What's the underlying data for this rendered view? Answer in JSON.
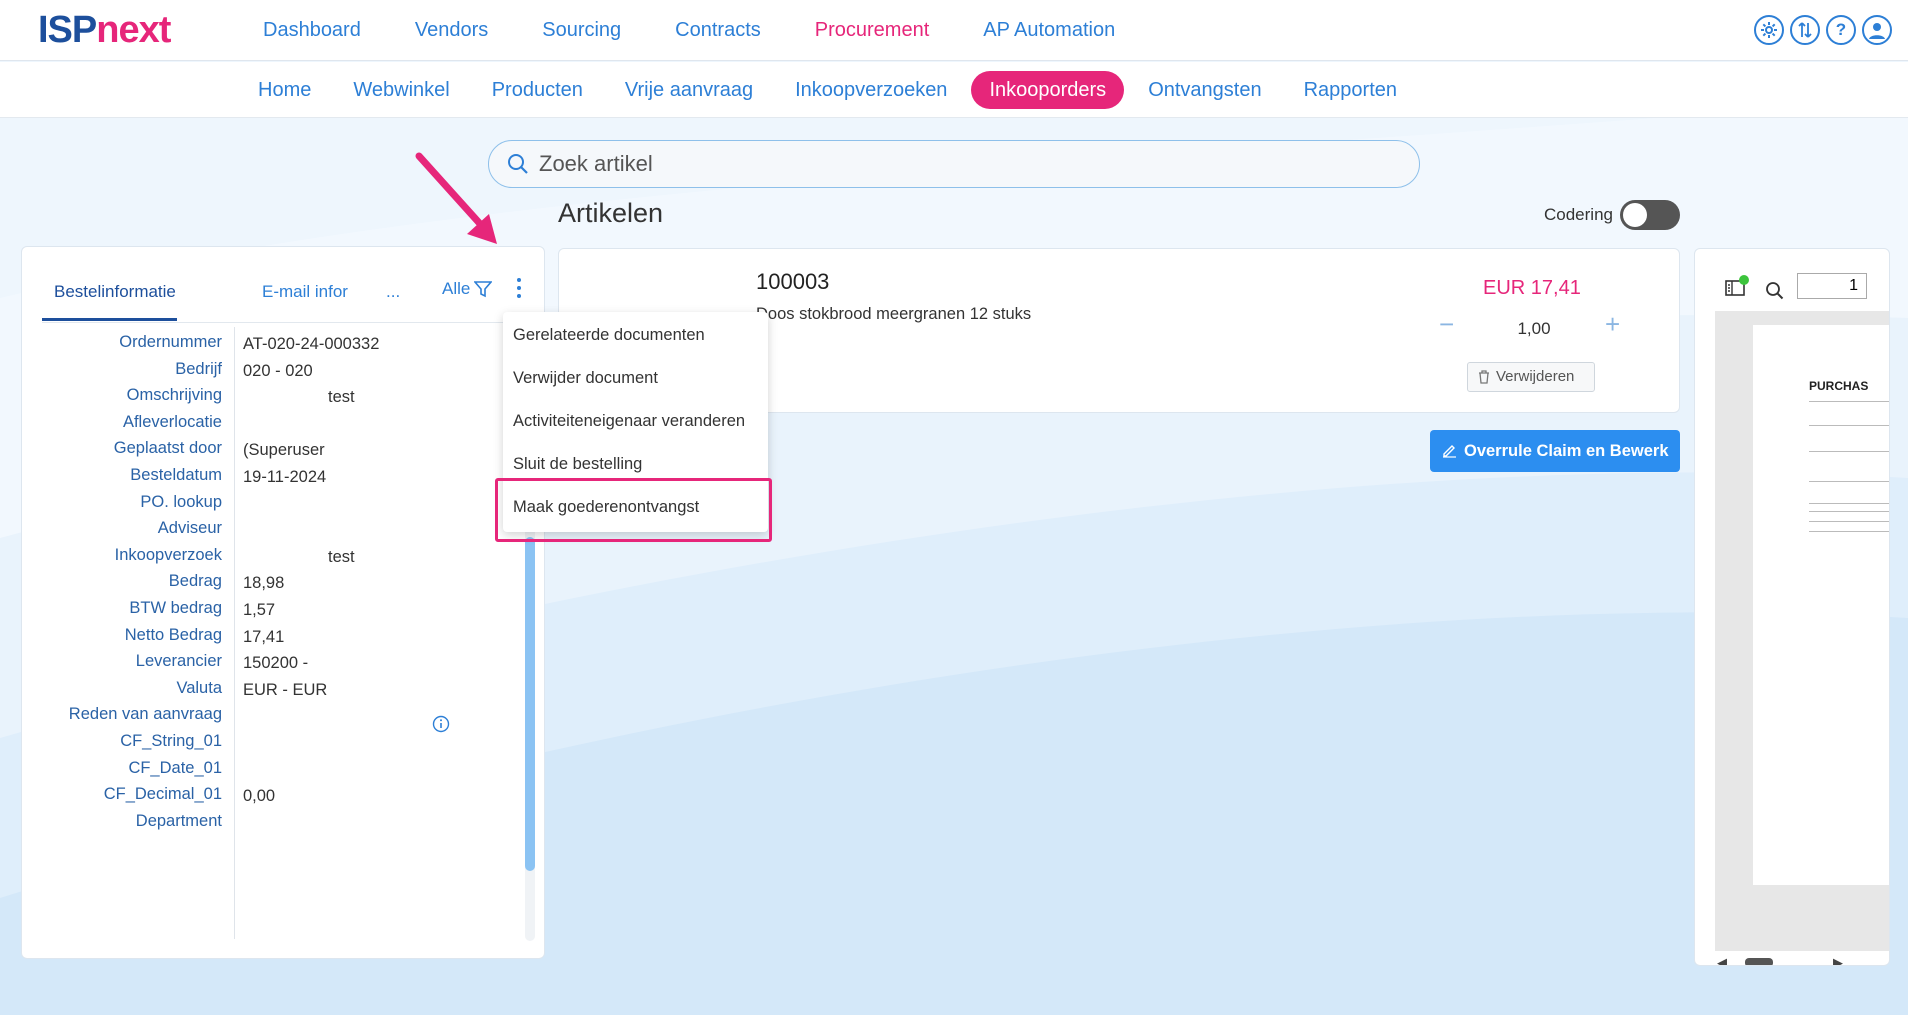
{
  "brand": {
    "part1": "ISP",
    "part2": "next",
    "color1": "#1d4f9c",
    "color2": "#e6267a"
  },
  "main_nav": [
    {
      "label": "Dashboard",
      "active": false
    },
    {
      "label": "Vendors",
      "active": false
    },
    {
      "label": "Sourcing",
      "active": false
    },
    {
      "label": "Contracts",
      "active": false
    },
    {
      "label": "Procurement",
      "active": true
    },
    {
      "label": "AP Automation",
      "active": false
    }
  ],
  "top_icons": [
    "gear-icon",
    "sync-icon",
    "help-icon",
    "user-icon"
  ],
  "sub_nav": [
    {
      "label": "Home",
      "active": false
    },
    {
      "label": "Webwinkel",
      "active": false
    },
    {
      "label": "Producten",
      "active": false
    },
    {
      "label": "Vrije aanvraag",
      "active": false
    },
    {
      "label": "Inkoopverzoeken",
      "active": false
    },
    {
      "label": "Inkooporders",
      "active": true
    },
    {
      "label": "Ontvangsten",
      "active": false
    },
    {
      "label": "Rapporten",
      "active": false
    }
  ],
  "search": {
    "placeholder": "Zoek artikel"
  },
  "left_panel": {
    "tabs": {
      "t1": "Bestelinformatie",
      "t2": "E-mail infor",
      "t3": "..."
    },
    "filter_label": "Alle",
    "fields": [
      {
        "label": "Ordernummer",
        "value": "AT-020-24-000332",
        "indent": false
      },
      {
        "label": "Bedrijf",
        "value": "020 - 020",
        "indent": false
      },
      {
        "label": "Omschrijving",
        "value": "test",
        "indent": true
      },
      {
        "label": "Afleverlocatie",
        "value": "",
        "indent": false
      },
      {
        "label": "Geplaatst door",
        "value": "(Superuser",
        "indent": false
      },
      {
        "label": "Besteldatum",
        "value": "19-11-2024",
        "indent": false
      },
      {
        "label": "PO. lookup",
        "value": "",
        "indent": false
      },
      {
        "label": "Adviseur",
        "value": "",
        "indent": false
      },
      {
        "label": "Inkoopverzoek",
        "value": "test",
        "indent": true
      },
      {
        "label": "Bedrag",
        "value": "18,98",
        "indent": false
      },
      {
        "label": "BTW bedrag",
        "value": "1,57",
        "indent": false
      },
      {
        "label": "Netto Bedrag",
        "value": "17,41",
        "indent": false
      },
      {
        "label": "Leverancier",
        "value": "150200 -",
        "indent": false
      },
      {
        "label": "Valuta",
        "value": "EUR - EUR",
        "indent": false
      },
      {
        "label": "Reden van aanvraag",
        "value": "",
        "indent": false
      },
      {
        "label": "CF_String_01",
        "value": "",
        "indent": false
      },
      {
        "label": "CF_Date_01",
        "value": "",
        "indent": false
      },
      {
        "label": "CF_Decimal_01",
        "value": "0,00",
        "indent": false
      },
      {
        "label": "Department",
        "value": "",
        "indent": false
      }
    ]
  },
  "menu": {
    "items": [
      "Gerelateerde documenten",
      "Verwijder document",
      "Activiteiteneigenaar veranderen",
      "Sluit de bestelling",
      "Maak goederenontvangst"
    ]
  },
  "articles": {
    "title": "Artikelen",
    "codering_label": "Codering",
    "item": {
      "code": "100003",
      "description": "Doos stokbrood meergranen 12 stuks",
      "price": "EUR 17,41",
      "minus": "−",
      "quantity": "1,00",
      "plus": "+",
      "delete_label": "Verwijderen"
    },
    "override_label": "Overrule Claim en Bewerk"
  },
  "preview": {
    "page_number": "1",
    "doc_title": "PURCHAS"
  }
}
